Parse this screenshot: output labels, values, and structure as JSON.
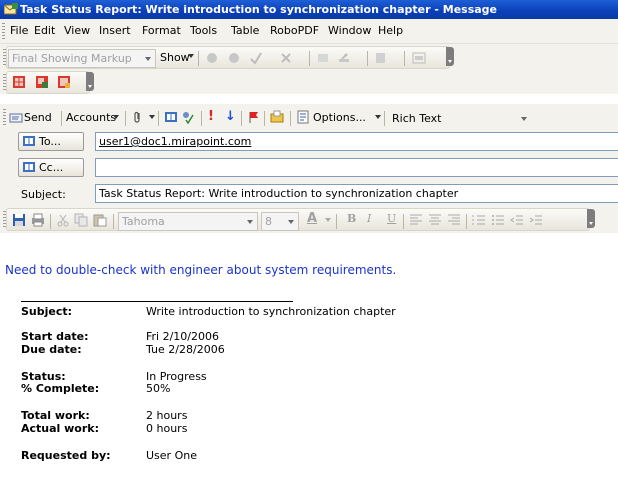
{
  "window": {
    "title": "Task Status Report: Write introduction to synchronization chapter - Message"
  },
  "menu": [
    "File",
    "Edit",
    "View",
    "Insert",
    "Format",
    "Tools",
    "Table",
    "RoboPDF",
    "Window",
    "Help"
  ],
  "review_toolbar": {
    "display_dropdown": "Final Showing Markup",
    "show_label": "Show"
  },
  "mail_toolbar": {
    "send_label": "Send",
    "accounts_label": "Accounts",
    "options_label": "Options...",
    "format_dropdown": "Rich Text"
  },
  "header": {
    "to_label": "To...",
    "to_value": "user1@doc1.mirapoint.com",
    "cc_label": "Cc...",
    "cc_value": "",
    "subject_label": "Subject:",
    "subject_value": "Task Status Report: Write introduction to synchronization chapter"
  },
  "format_toolbar": {
    "font": "Tahoma",
    "size": "8"
  },
  "body": {
    "note": "Need to double-check with engineer about system requirements.",
    "fields": [
      {
        "label": "Subject:",
        "value": "Write introduction to synchronization chapter"
      },
      {
        "label": "Start date:",
        "value": "Fri 2/10/2006"
      },
      {
        "label": "Due date:",
        "value": "Tue 2/28/2006"
      },
      {
        "label": "Status:",
        "value": "In Progress"
      },
      {
        "label": "% Complete:",
        "value": "50%"
      },
      {
        "label": "Total work:",
        "value": "2 hours"
      },
      {
        "label": "Actual work:",
        "value": "0 hours"
      },
      {
        "label": "Requested by:",
        "value": "User One"
      }
    ]
  },
  "colors": {
    "titlebar": "#0a3fb8",
    "note_text": "#1a33cc",
    "toolbar_bg": "#f3f2ec"
  }
}
